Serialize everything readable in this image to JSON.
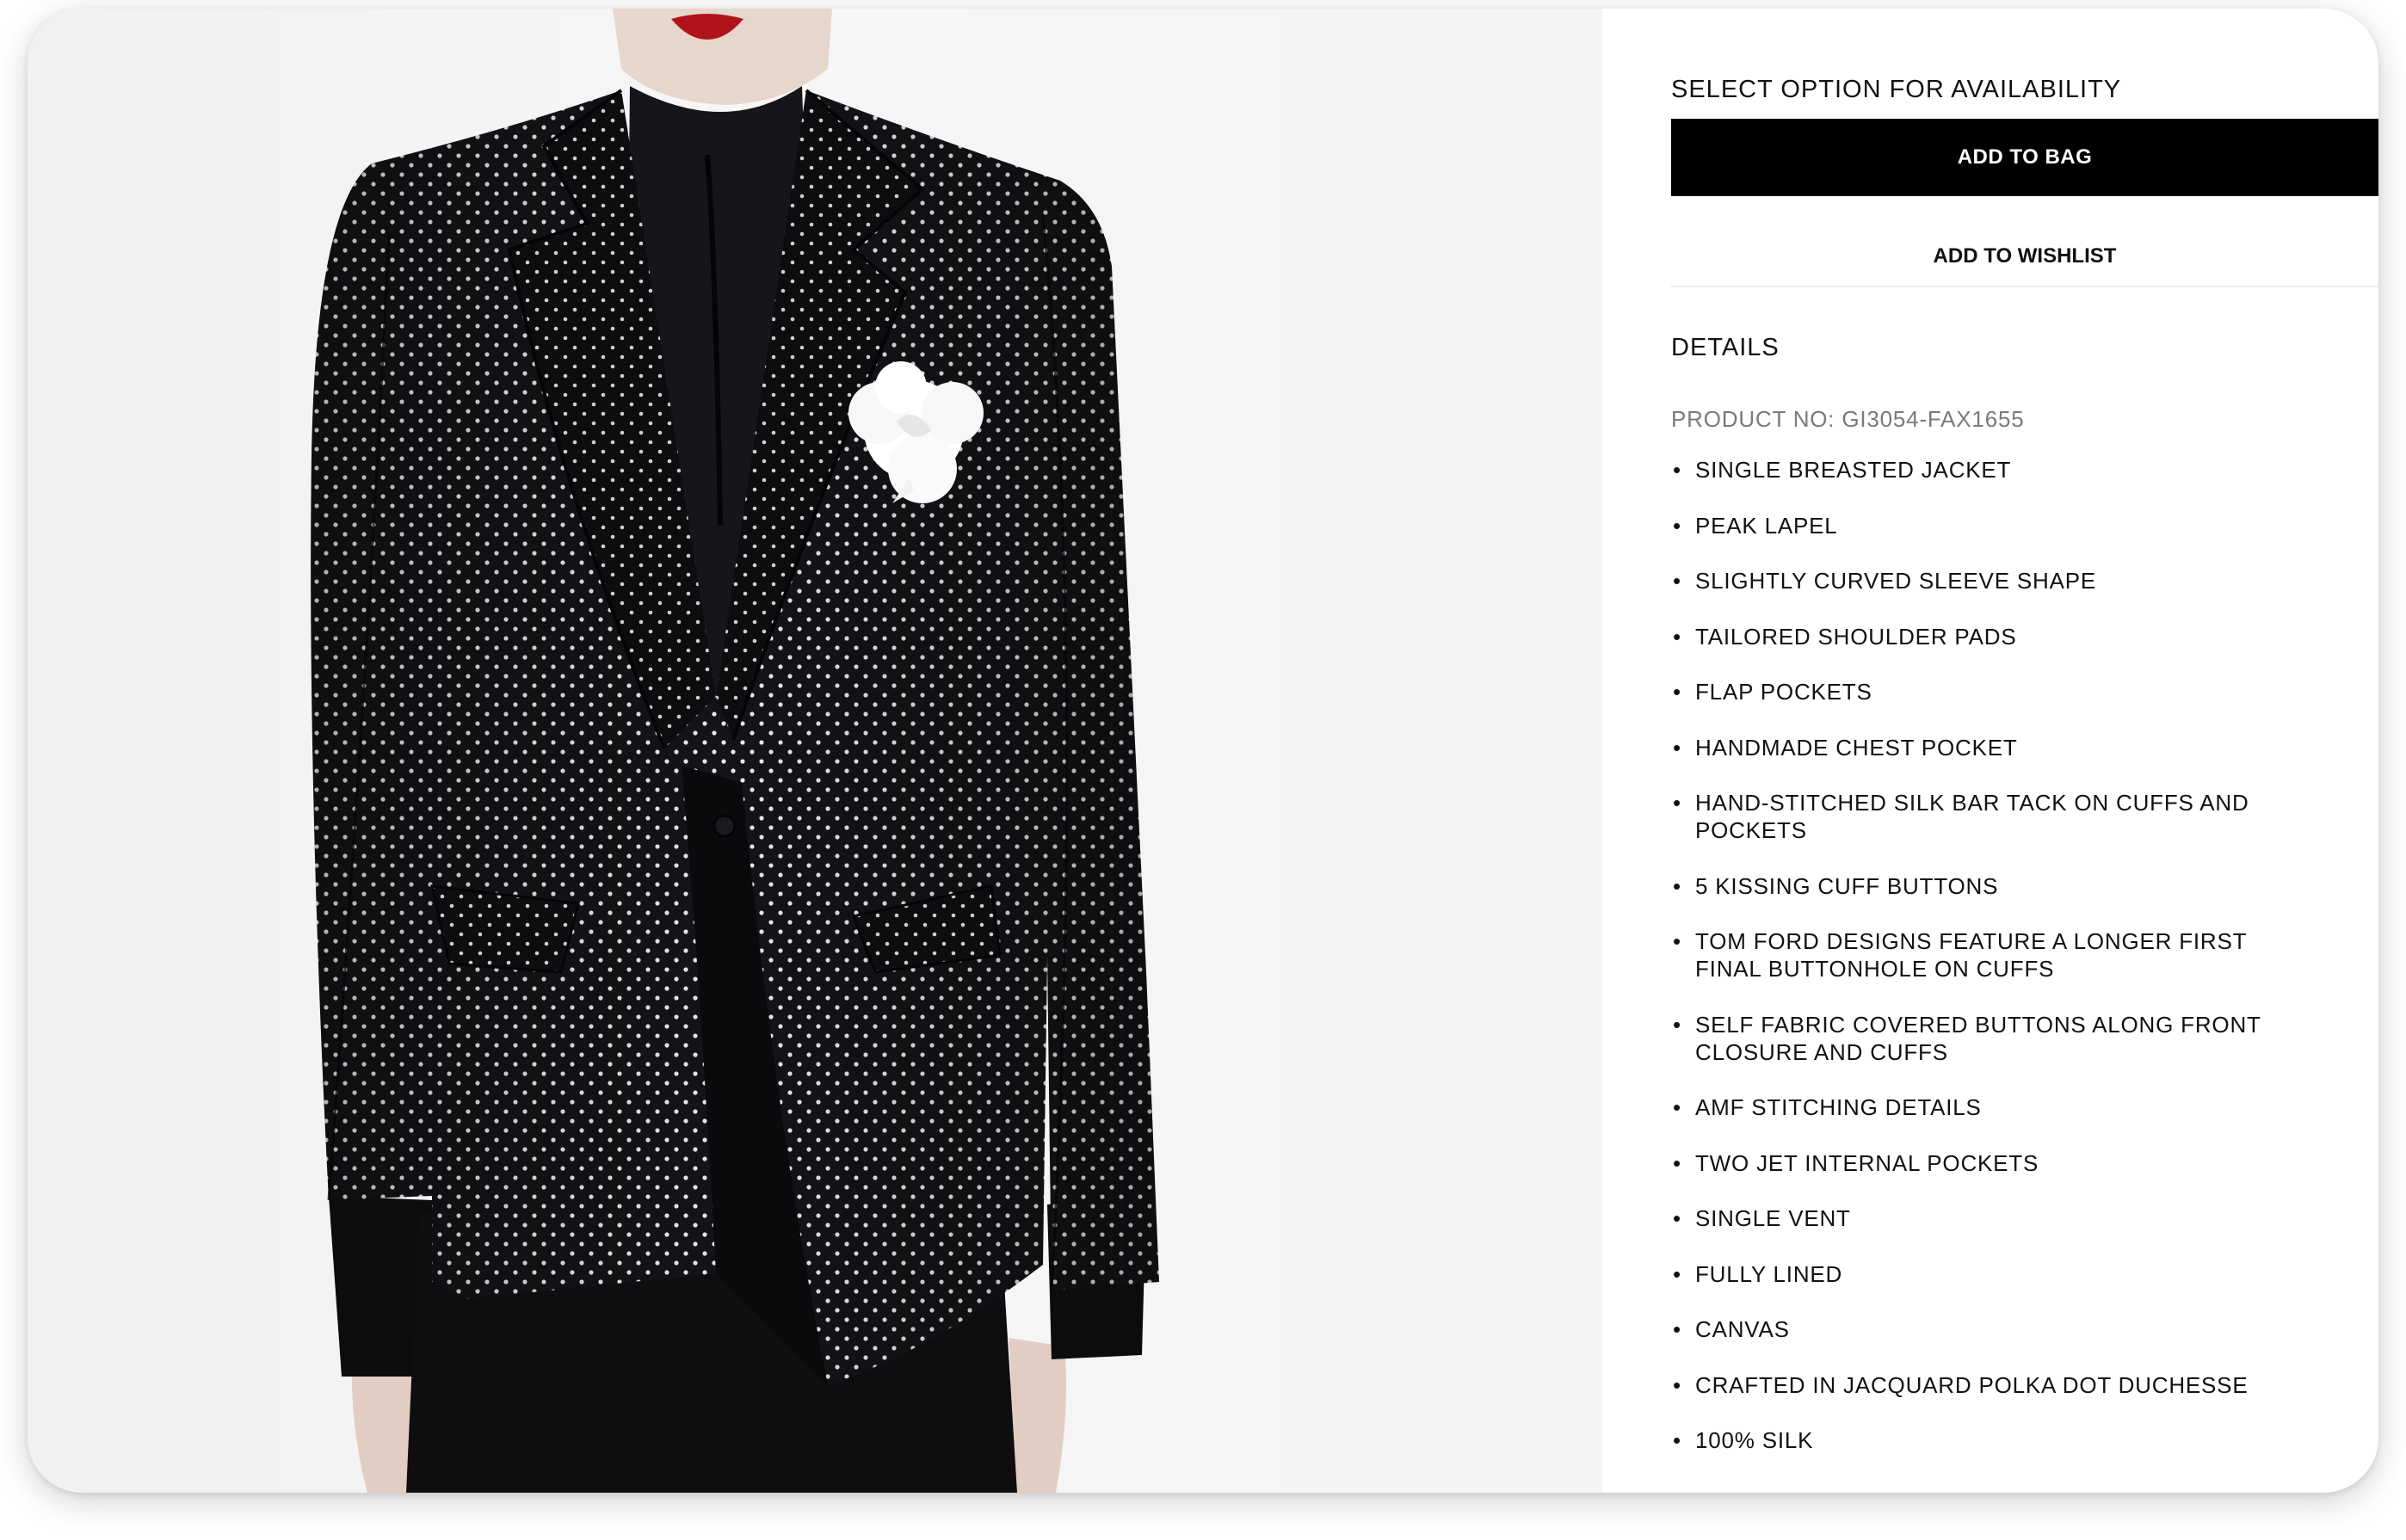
{
  "product": {
    "availability_label": "SELECT OPTION FOR AVAILABILITY",
    "add_to_bag_label": "ADD TO BAG",
    "add_to_wishlist_label": "ADD TO WISHLIST",
    "details_heading": "DETAILS",
    "product_no": "PRODUCT NO: GI3054-FAX1655",
    "features": [
      "SINGLE BREASTED JACKET",
      "PEAK LAPEL",
      "SLIGHTLY CURVED SLEEVE SHAPE",
      "TAILORED SHOULDER PADS",
      "FLAP POCKETS",
      "HANDMADE CHEST POCKET",
      "HAND-STITCHED SILK BAR TACK ON CUFFS AND POCKETS",
      " 5 KISSING CUFF BUTTONS",
      "TOM FORD DESIGNS FEATURE A LONGER FIRST FINAL BUTTONHOLE ON CUFFS",
      "SELF FABRIC COVERED BUTTONS ALONG FRONT CLOSURE AND CUFFS",
      "AMF STITCHING DETAILS",
      "TWO JET INTERNAL POCKETS",
      "SINGLE VENT",
      "FULLY LINED",
      "CANVAS",
      "CRAFTED IN JACQUARD POLKA DOT DUCHESSE",
      "100% SILK"
    ]
  },
  "colors": {
    "button_bg": "#000000",
    "button_text": "#ffffff",
    "muted_text": "#7a7a7a",
    "jacket": "#111115",
    "dot": "#e8e8e8",
    "flower": "#ffffff",
    "lips": "#b0141a"
  },
  "icons": {
    "product_image": "model-wearing-polka-dot-jacket"
  }
}
